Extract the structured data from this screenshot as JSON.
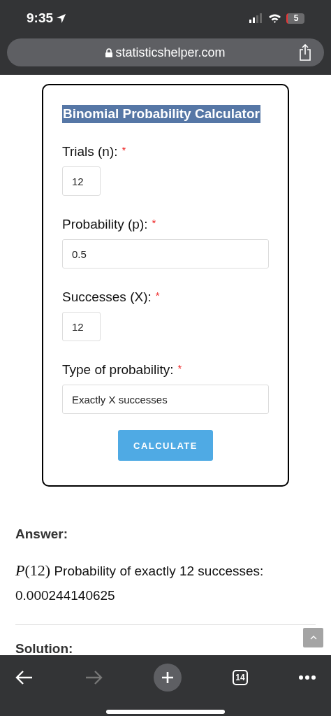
{
  "status_bar": {
    "time": "9:35",
    "battery": "5"
  },
  "address_bar": {
    "url": "statisticshelper.com"
  },
  "form": {
    "title": "Binomial Probability Calculator",
    "fields": [
      {
        "label": "Trials (n):",
        "marker": "*",
        "value": "12",
        "kind": "short"
      },
      {
        "label": "Probability (p):",
        "marker": "*",
        "value": "0.5",
        "kind": "long"
      },
      {
        "label": "Successes (X):",
        "marker": "*",
        "value": "12",
        "kind": "short"
      },
      {
        "label": "Type of probability:",
        "marker": "*",
        "value": "Exactly X successes",
        "kind": "long"
      }
    ],
    "button": "CALCULATE"
  },
  "answer": {
    "heading": "Answer:",
    "formula": "*P*(12)",
    "text": "Probability of exactly 12 successes:",
    "value": "0.000244140625"
  },
  "solution_heading": "Solution:",
  "toolbar": {
    "back_disabled": false,
    "forward_disabled": true,
    "tab_count": "14"
  }
}
